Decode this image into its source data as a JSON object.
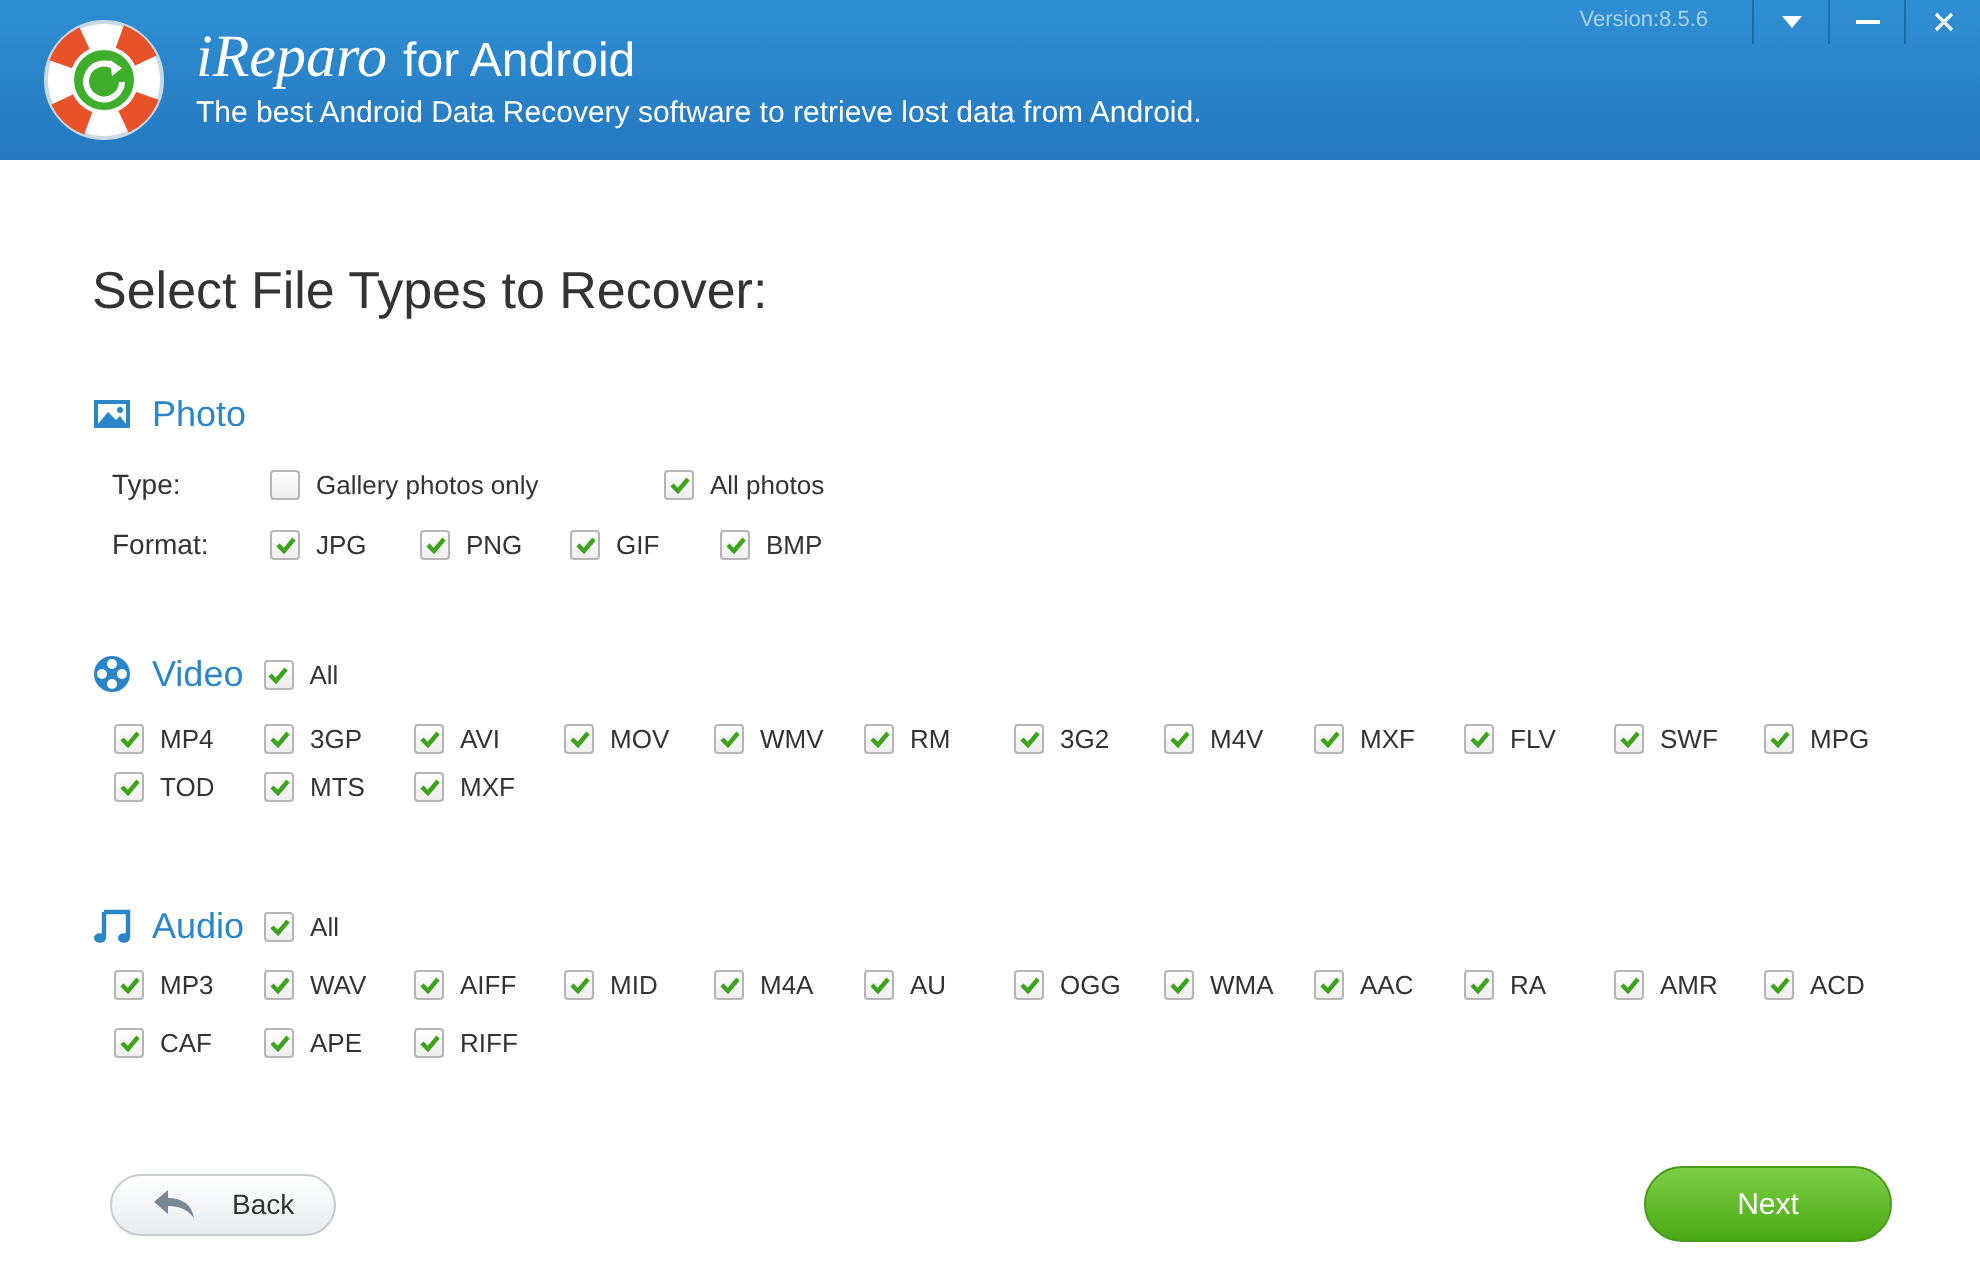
{
  "header": {
    "brand": "iReparo",
    "brand_suffix": "for Android",
    "tagline": "The best Android Data Recovery software to retrieve lost data from Android.",
    "version": "Version:8.5.6"
  },
  "page_title": "Select File Types to Recover:",
  "photo": {
    "label": "Photo",
    "type_label": "Type:",
    "type_options": [
      {
        "label": "Gallery photos only",
        "checked": false
      },
      {
        "label": "All photos",
        "checked": true
      }
    ],
    "format_label": "Format:",
    "formats": [
      {
        "label": "JPG",
        "checked": true
      },
      {
        "label": "PNG",
        "checked": true
      },
      {
        "label": "GIF",
        "checked": true
      },
      {
        "label": "BMP",
        "checked": true
      }
    ]
  },
  "video": {
    "label": "Video",
    "all": {
      "label": "All",
      "checked": true
    },
    "items": [
      {
        "label": "MP4",
        "checked": true
      },
      {
        "label": "3GP",
        "checked": true
      },
      {
        "label": "AVI",
        "checked": true
      },
      {
        "label": "MOV",
        "checked": true
      },
      {
        "label": "WMV",
        "checked": true
      },
      {
        "label": "RM",
        "checked": true
      },
      {
        "label": "3G2",
        "checked": true
      },
      {
        "label": "M4V",
        "checked": true
      },
      {
        "label": "MXF",
        "checked": true
      },
      {
        "label": "FLV",
        "checked": true
      },
      {
        "label": "SWF",
        "checked": true
      },
      {
        "label": "MPG",
        "checked": true
      },
      {
        "label": "TOD",
        "checked": true
      },
      {
        "label": "MTS",
        "checked": true
      },
      {
        "label": "MXF",
        "checked": true
      }
    ]
  },
  "audio": {
    "label": "Audio",
    "all": {
      "label": "All",
      "checked": true
    },
    "items": [
      {
        "label": "MP3",
        "checked": true
      },
      {
        "label": "WAV",
        "checked": true
      },
      {
        "label": "AIFF",
        "checked": true
      },
      {
        "label": "MID",
        "checked": true
      },
      {
        "label": "M4A",
        "checked": true
      },
      {
        "label": "AU",
        "checked": true
      },
      {
        "label": "OGG",
        "checked": true
      },
      {
        "label": "WMA",
        "checked": true
      },
      {
        "label": "AAC",
        "checked": true
      },
      {
        "label": "RA",
        "checked": true
      },
      {
        "label": "AMR",
        "checked": true
      },
      {
        "label": "ACD",
        "checked": true
      },
      {
        "label": "CAF",
        "checked": true
      },
      {
        "label": "APE",
        "checked": true
      },
      {
        "label": "RIFF",
        "checked": true
      }
    ]
  },
  "buttons": {
    "back": "Back",
    "next": "Next"
  }
}
